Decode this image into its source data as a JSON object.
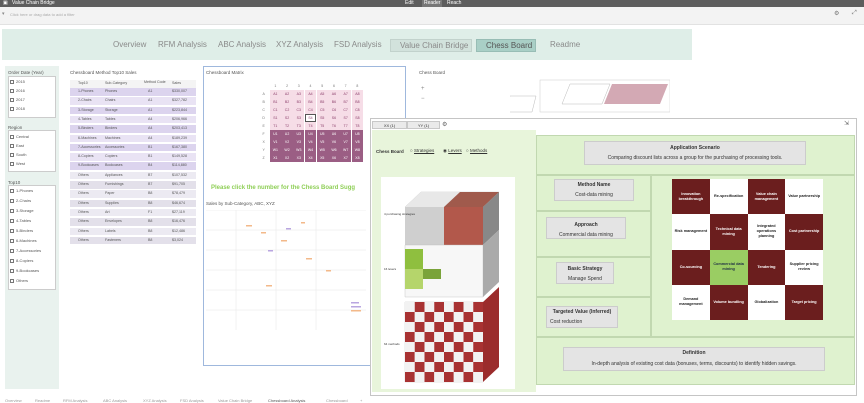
{
  "window": {
    "title": "Value Chain Bridge",
    "right_labels": [
      "Edit",
      "Reader",
      "Reach"
    ]
  },
  "filter_bar": {
    "placeholder": "Click here or drag data to add a filter"
  },
  "nav_tabs": [
    "Overview",
    "RFM Analysis",
    "ABC Analysis",
    "XYZ Analysis",
    "FSD Analysis",
    "Value Chain Bridge",
    "Chess Board",
    "Readme"
  ],
  "filters": {
    "order_date": {
      "title": "Order Date (Year)",
      "items": [
        "2015",
        "2016",
        "2017",
        "2018"
      ]
    },
    "region": {
      "title": "Region",
      "items": [
        "Central",
        "East",
        "South",
        "West"
      ]
    },
    "top10": {
      "title": "Top10",
      "items": [
        "1-Phones",
        "2-Chairs",
        "3-Storage",
        "4-Tables",
        "5-Binders",
        "6-Machines",
        "7-Accessories",
        "8-Copiers",
        "9-Bookcases",
        "Others"
      ]
    }
  },
  "method_table": {
    "title": "Chessboard Method Top10 Sales",
    "headers": [
      "Top10",
      "Sub-Category",
      "Method Code",
      "Sales"
    ],
    "rows": [
      [
        "1-Phones",
        "Phones",
        "A1",
        "$330,007"
      ],
      [
        "2-Chairs",
        "Chairs",
        "A1",
        "$327,782"
      ],
      [
        "3-Storage",
        "Storage",
        "A1",
        "$223,844"
      ],
      [
        "4-Tables",
        "Tables",
        "A4",
        "$206,966"
      ],
      [
        "5-Binders",
        "Binders",
        "A4",
        "$203,413"
      ],
      [
        "6-Machines",
        "Machines",
        "A4",
        "$189,239"
      ],
      [
        "7-Accessories",
        "Accessories",
        "B1",
        "$167,380"
      ],
      [
        "8-Copiers",
        "Copiers",
        "B1",
        "$149,528"
      ],
      [
        "9-Bookcases",
        "Bookcases",
        "B4",
        "$114,880"
      ],
      [
        "Others",
        "Appliances",
        "B7",
        "$107,532"
      ],
      [
        "Others",
        "Furnishings",
        "B7",
        "$91,705"
      ],
      [
        "Others",
        "Paper",
        "B8",
        "$78,479"
      ],
      [
        "Others",
        "Supplies",
        "B8",
        "$46,674"
      ],
      [
        "Others",
        "Art",
        "F1",
        "$27,119"
      ],
      [
        "Others",
        "Envelopes",
        "B8",
        "$16,476"
      ],
      [
        "Others",
        "Labels",
        "B8",
        "$12,486"
      ],
      [
        "Others",
        "Fasteners",
        "B8",
        "$3,024"
      ]
    ]
  },
  "matrix": {
    "title": "Chessboard Matrix",
    "cols": [
      "1",
      "2",
      "3",
      "4",
      "5",
      "6",
      "7",
      "8"
    ],
    "rows": [
      "A",
      "B",
      "C",
      "D",
      "E",
      "F",
      "X",
      "Y",
      "Z"
    ],
    "selected": "S4"
  },
  "matrix_prompt": "Please click the number for the Chess Board Sugg",
  "sales_title": "Sales by Sub-Category, ABC, XYZ",
  "chess_board_title": "Chess Board",
  "overlay": {
    "btn_xx": "XX (1)",
    "btn_yy": "YY (1)",
    "chess_board_label": "Chess Board",
    "radio_options": [
      "Strategies",
      "Levers",
      "Methods"
    ],
    "radio_selected": "Levers",
    "app_scenario": {
      "title": "Application Scenario",
      "text": "Comparing discount lists across a group for the purchasing of processing tools."
    },
    "method_name": {
      "title": "Method Name",
      "text": "Cost-data mining"
    },
    "approach": {
      "title": "Approach",
      "text": "Commercial data mining"
    },
    "basic_strategy": {
      "title": "Basic Strategy",
      "text": "Manage Spend"
    },
    "targeted_value": {
      "title": "Targeted Value (Inferred)",
      "text": "Cost reduction"
    },
    "definition": {
      "title": "Definition",
      "text": "In-depth analysis of existing cost data (bonuses, terms, discounts) to identify hidden savings."
    },
    "chess_grid": [
      [
        "Innovation breakthrough",
        "Re-specification",
        "Value chain management",
        "Value partnership"
      ],
      [
        "Risk management",
        "Technical data mining",
        "Integrated operations planning",
        "Cost partnership"
      ],
      [
        "Co-sourcing",
        "Commercial data mining",
        "Tendering",
        "Supplier pricing review"
      ],
      [
        "Demand management",
        "Volume bundling",
        "Globalization",
        "Target pricing"
      ]
    ],
    "grid_pattern": [
      [
        "dk",
        "lt",
        "dk",
        "lt"
      ],
      [
        "lt",
        "dk",
        "lt",
        "dk"
      ],
      [
        "dk",
        "gn",
        "dk",
        "lt"
      ],
      [
        "lt",
        "dk",
        "lt",
        "dk"
      ]
    ],
    "cube_labels": [
      "4 purchasing strategies",
      "16 levers",
      "64 methods"
    ]
  },
  "bottom_tabs": [
    "Overview",
    "Readme",
    "RFM Analysis",
    "ABC Analysis",
    "XYZ Analysis",
    "FSD Analysis",
    "Value Chain Bridge",
    "Chessboard Analysis",
    "Chessboard",
    "+"
  ],
  "colors": {
    "accent": "#a9cfc6",
    "dark_cell": "#6b1e1e",
    "green_cell": "#9acd63",
    "matrix_dark": "#9b5e84",
    "matrix_light": "#f6dde7"
  }
}
